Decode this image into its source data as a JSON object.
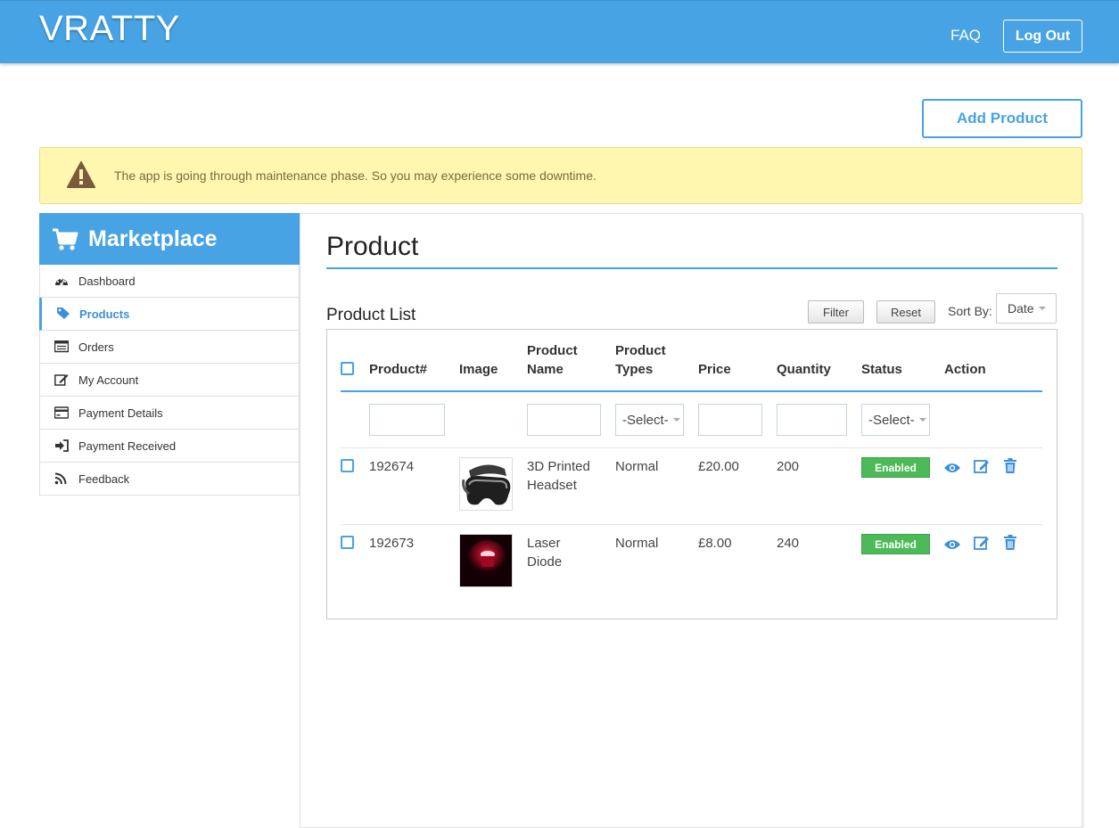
{
  "header": {
    "logo": "VRATTY",
    "faq": "FAQ",
    "logout": "Log Out"
  },
  "toolbar": {
    "add_product": "Add Product"
  },
  "alert": {
    "message": "The app is going through maintenance phase. So you may experience some downtime."
  },
  "sidebar": {
    "title": "Marketplace",
    "items": [
      {
        "label": "Dashboard",
        "icon": "dashboard-icon"
      },
      {
        "label": "Products",
        "icon": "tag-icon",
        "active": true
      },
      {
        "label": "Orders",
        "icon": "list-icon"
      },
      {
        "label": "My Account",
        "icon": "edit-icon"
      },
      {
        "label": "Payment Details",
        "icon": "credit-card-icon"
      },
      {
        "label": "Payment Received",
        "icon": "sign-in-icon"
      },
      {
        "label": "Feedback",
        "icon": "rss-icon"
      }
    ]
  },
  "main": {
    "title": "Product",
    "list_title": "Product List",
    "filter": "Filter",
    "reset": "Reset",
    "sort_label": "Sort By:",
    "sort_value": "Date",
    "columns": {
      "product_no": "Product#",
      "image": "Image",
      "name_1": "Product",
      "name_2": "Name",
      "types_1": "Product",
      "types_2": "Types",
      "price": "Price",
      "quantity": "Quantity",
      "status": "Status",
      "action": "Action"
    },
    "filters": {
      "types_select": "-Select-",
      "status_select": "-Select-"
    },
    "rows": [
      {
        "id": "192674",
        "name_1": "3D Printed",
        "name_2": "Headset",
        "type": "Normal",
        "price": "£20.00",
        "quantity": "200",
        "status": "Enabled"
      },
      {
        "id": "192673",
        "name_1": "Laser",
        "name_2": "Diode",
        "type": "Normal",
        "price": "£8.00",
        "quantity": "240",
        "status": "Enabled"
      }
    ]
  },
  "colors": {
    "accent": "#47a3e3",
    "alert_bg": "#fff7b0",
    "enabled": "#4cba58"
  }
}
